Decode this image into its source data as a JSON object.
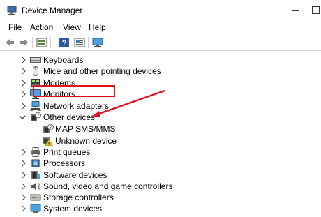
{
  "window": {
    "title": "Device Manager"
  },
  "menu": [
    "File",
    "Action",
    "View",
    "Help"
  ],
  "toolbar": [
    "back-icon",
    "forward-icon",
    "properties-icon",
    "help-icon",
    "view-icon",
    "monitor-icon"
  ],
  "tree": {
    "items": [
      {
        "label": "Keyboards",
        "icon": "keyboard-icon",
        "expanded": false
      },
      {
        "label": "Mice and other pointing devices",
        "icon": "mouse-icon",
        "expanded": false
      },
      {
        "label": "Modems",
        "icon": "modem-icon",
        "expanded": false
      },
      {
        "label": "Monitors",
        "icon": "monitor-icon",
        "expanded": false
      },
      {
        "label": "Network adapters",
        "icon": "network-icon",
        "expanded": false
      },
      {
        "label": "Other devices",
        "icon": "unknown-category-icon",
        "expanded": true,
        "children": [
          {
            "label": "MAP SMS/MMS",
            "icon": "unknown-device-icon"
          },
          {
            "label": "Unknown device",
            "icon": "warning-device-icon"
          }
        ]
      },
      {
        "label": "Print queues",
        "icon": "printer-icon",
        "expanded": false
      },
      {
        "label": "Processors",
        "icon": "processor-icon",
        "expanded": false
      },
      {
        "label": "Software devices",
        "icon": "software-icon",
        "expanded": false
      },
      {
        "label": "Sound, video and game controllers",
        "icon": "sound-icon",
        "expanded": false
      },
      {
        "label": "Storage controllers",
        "icon": "storage-icon",
        "expanded": false
      },
      {
        "label": "System devices",
        "icon": "system-icon",
        "expanded": false
      }
    ]
  },
  "annotation_color": "#e0101e"
}
